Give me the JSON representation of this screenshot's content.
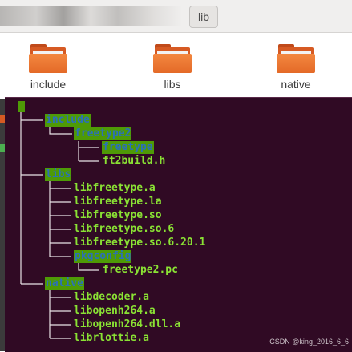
{
  "file_manager": {
    "path_button": "lib",
    "folders": [
      {
        "label": "include",
        "icon": "folder-icon"
      },
      {
        "label": "libs",
        "icon": "folder-icon"
      },
      {
        "label": "native",
        "icon": "folder-icon"
      }
    ]
  },
  "terminal": {
    "background": "#300a24",
    "file_color": "#8ae234",
    "dir_highlight": "#4e9a06",
    "tree": {
      "include": "include",
      "freetype2": "freetype2",
      "freetype": "freetype",
      "ft2build": "ft2build.h",
      "libs": "libs",
      "libfreetype_a": "libfreetype.a",
      "libfreetype_la": "libfreetype.la",
      "libfreetype_so": "libfreetype.so",
      "libfreetype_so_6": "libfreetype.so.6",
      "libfreetype_so_6_20_1": "libfreetype.so.6.20.1",
      "pkgconfig": "pkgconfig",
      "freetype2_pc": "freetype2.pc",
      "native": "native",
      "libdecoder": "libdecoder.a",
      "libopenh264": "libopenh264.a",
      "libopenh264_dll": "libopenh264.dll.a",
      "librlottie": "librlottie.a"
    }
  },
  "watermark": "CSDN @king_2016_6_6"
}
